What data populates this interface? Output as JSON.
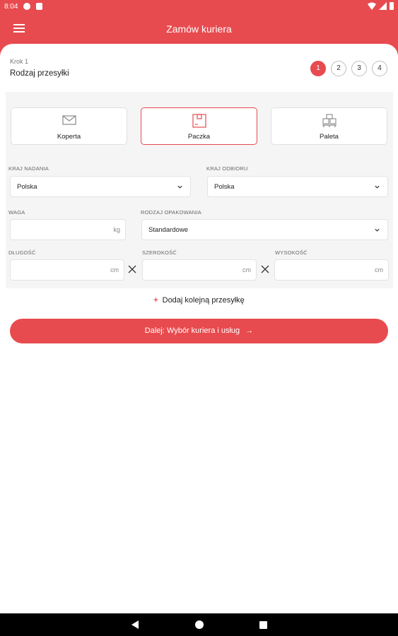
{
  "status_bar": {
    "time": "8:04"
  },
  "app_bar": {
    "title": "Zamów kuriera"
  },
  "step": {
    "caption": "Krok 1",
    "title": "Rodzaj przesyłki",
    "steps": [
      "1",
      "2",
      "3",
      "4"
    ],
    "active_step": "1"
  },
  "shipment_types": [
    {
      "label": "Koperta",
      "icon": "envelope-icon",
      "selected": false
    },
    {
      "label": "Paczka",
      "icon": "box-icon",
      "selected": true
    },
    {
      "label": "Paleta",
      "icon": "pallet-icon",
      "selected": false
    }
  ],
  "form": {
    "origin_label": "KRAJ NADANIA",
    "origin_value": "Polska",
    "dest_label": "KRAJ ODBIORU",
    "dest_value": "Polska",
    "weight_label": "WAGA",
    "weight_value": "",
    "weight_unit": "kg",
    "packaging_label": "RODZAJ OPAKOWANIA",
    "packaging_value": "Standardowe",
    "length_label": "DŁUGOŚĆ",
    "length_value": "",
    "width_label": "SZEROKOŚĆ",
    "width_value": "",
    "height_label": "WYSOKOŚĆ",
    "height_value": "",
    "dim_unit": "cm"
  },
  "add_link": {
    "plus": "+",
    "label": "Dodaj kolejną przesyłkę"
  },
  "next_button": {
    "label": "Dalej: Wybór kuriera i usług",
    "arrow": "→"
  },
  "colors": {
    "accent": "#e84b4f",
    "panel": "#f5f5f5"
  }
}
